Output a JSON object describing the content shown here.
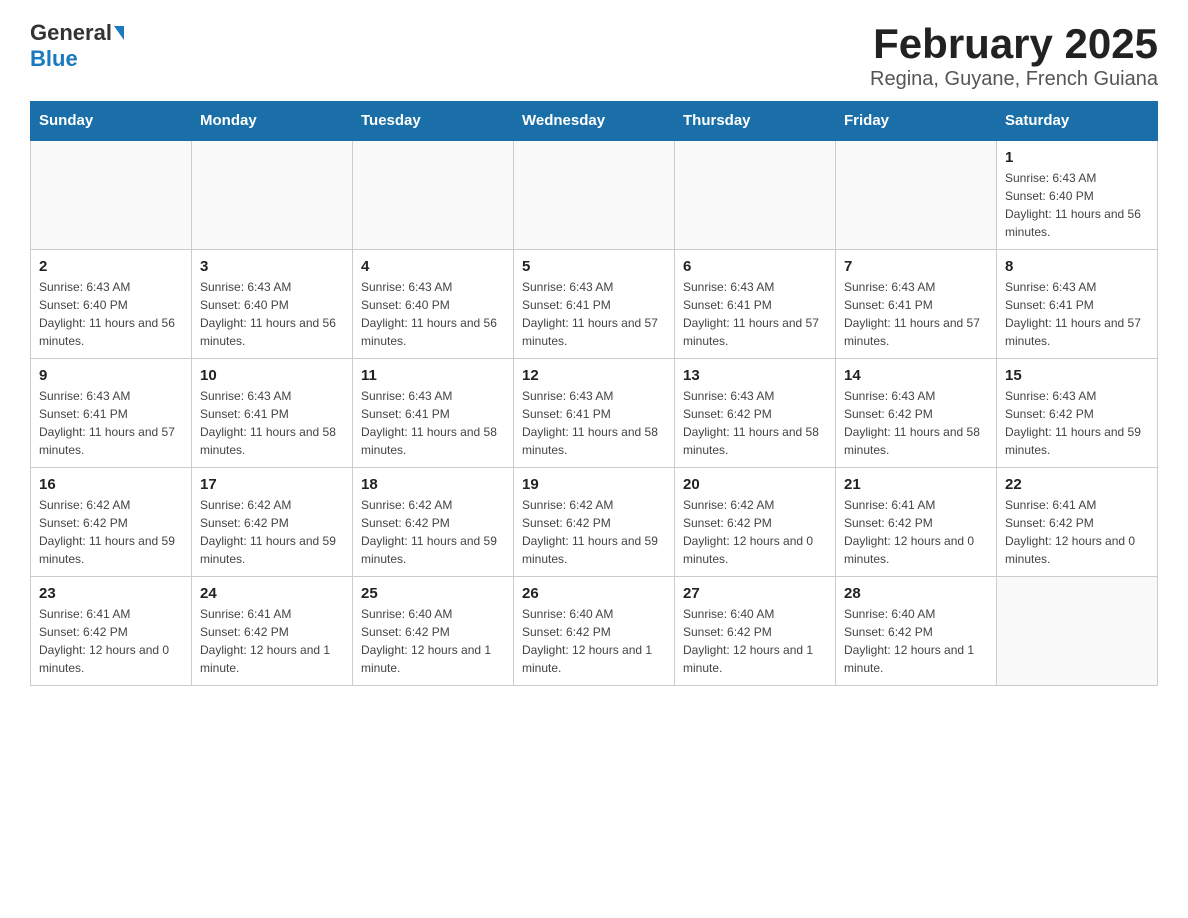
{
  "header": {
    "logo_general": "General",
    "logo_blue": "Blue",
    "title": "February 2025",
    "subtitle": "Regina, Guyane, French Guiana"
  },
  "days_of_week": [
    "Sunday",
    "Monday",
    "Tuesday",
    "Wednesday",
    "Thursday",
    "Friday",
    "Saturday"
  ],
  "weeks": [
    [
      {
        "day": "",
        "info": ""
      },
      {
        "day": "",
        "info": ""
      },
      {
        "day": "",
        "info": ""
      },
      {
        "day": "",
        "info": ""
      },
      {
        "day": "",
        "info": ""
      },
      {
        "day": "",
        "info": ""
      },
      {
        "day": "1",
        "info": "Sunrise: 6:43 AM\nSunset: 6:40 PM\nDaylight: 11 hours and 56 minutes."
      }
    ],
    [
      {
        "day": "2",
        "info": "Sunrise: 6:43 AM\nSunset: 6:40 PM\nDaylight: 11 hours and 56 minutes."
      },
      {
        "day": "3",
        "info": "Sunrise: 6:43 AM\nSunset: 6:40 PM\nDaylight: 11 hours and 56 minutes."
      },
      {
        "day": "4",
        "info": "Sunrise: 6:43 AM\nSunset: 6:40 PM\nDaylight: 11 hours and 56 minutes."
      },
      {
        "day": "5",
        "info": "Sunrise: 6:43 AM\nSunset: 6:41 PM\nDaylight: 11 hours and 57 minutes."
      },
      {
        "day": "6",
        "info": "Sunrise: 6:43 AM\nSunset: 6:41 PM\nDaylight: 11 hours and 57 minutes."
      },
      {
        "day": "7",
        "info": "Sunrise: 6:43 AM\nSunset: 6:41 PM\nDaylight: 11 hours and 57 minutes."
      },
      {
        "day": "8",
        "info": "Sunrise: 6:43 AM\nSunset: 6:41 PM\nDaylight: 11 hours and 57 minutes."
      }
    ],
    [
      {
        "day": "9",
        "info": "Sunrise: 6:43 AM\nSunset: 6:41 PM\nDaylight: 11 hours and 57 minutes."
      },
      {
        "day": "10",
        "info": "Sunrise: 6:43 AM\nSunset: 6:41 PM\nDaylight: 11 hours and 58 minutes."
      },
      {
        "day": "11",
        "info": "Sunrise: 6:43 AM\nSunset: 6:41 PM\nDaylight: 11 hours and 58 minutes."
      },
      {
        "day": "12",
        "info": "Sunrise: 6:43 AM\nSunset: 6:41 PM\nDaylight: 11 hours and 58 minutes."
      },
      {
        "day": "13",
        "info": "Sunrise: 6:43 AM\nSunset: 6:42 PM\nDaylight: 11 hours and 58 minutes."
      },
      {
        "day": "14",
        "info": "Sunrise: 6:43 AM\nSunset: 6:42 PM\nDaylight: 11 hours and 58 minutes."
      },
      {
        "day": "15",
        "info": "Sunrise: 6:43 AM\nSunset: 6:42 PM\nDaylight: 11 hours and 59 minutes."
      }
    ],
    [
      {
        "day": "16",
        "info": "Sunrise: 6:42 AM\nSunset: 6:42 PM\nDaylight: 11 hours and 59 minutes."
      },
      {
        "day": "17",
        "info": "Sunrise: 6:42 AM\nSunset: 6:42 PM\nDaylight: 11 hours and 59 minutes."
      },
      {
        "day": "18",
        "info": "Sunrise: 6:42 AM\nSunset: 6:42 PM\nDaylight: 11 hours and 59 minutes."
      },
      {
        "day": "19",
        "info": "Sunrise: 6:42 AM\nSunset: 6:42 PM\nDaylight: 11 hours and 59 minutes."
      },
      {
        "day": "20",
        "info": "Sunrise: 6:42 AM\nSunset: 6:42 PM\nDaylight: 12 hours and 0 minutes."
      },
      {
        "day": "21",
        "info": "Sunrise: 6:41 AM\nSunset: 6:42 PM\nDaylight: 12 hours and 0 minutes."
      },
      {
        "day": "22",
        "info": "Sunrise: 6:41 AM\nSunset: 6:42 PM\nDaylight: 12 hours and 0 minutes."
      }
    ],
    [
      {
        "day": "23",
        "info": "Sunrise: 6:41 AM\nSunset: 6:42 PM\nDaylight: 12 hours and 0 minutes."
      },
      {
        "day": "24",
        "info": "Sunrise: 6:41 AM\nSunset: 6:42 PM\nDaylight: 12 hours and 1 minute."
      },
      {
        "day": "25",
        "info": "Sunrise: 6:40 AM\nSunset: 6:42 PM\nDaylight: 12 hours and 1 minute."
      },
      {
        "day": "26",
        "info": "Sunrise: 6:40 AM\nSunset: 6:42 PM\nDaylight: 12 hours and 1 minute."
      },
      {
        "day": "27",
        "info": "Sunrise: 6:40 AM\nSunset: 6:42 PM\nDaylight: 12 hours and 1 minute."
      },
      {
        "day": "28",
        "info": "Sunrise: 6:40 AM\nSunset: 6:42 PM\nDaylight: 12 hours and 1 minute."
      },
      {
        "day": "",
        "info": ""
      }
    ]
  ]
}
